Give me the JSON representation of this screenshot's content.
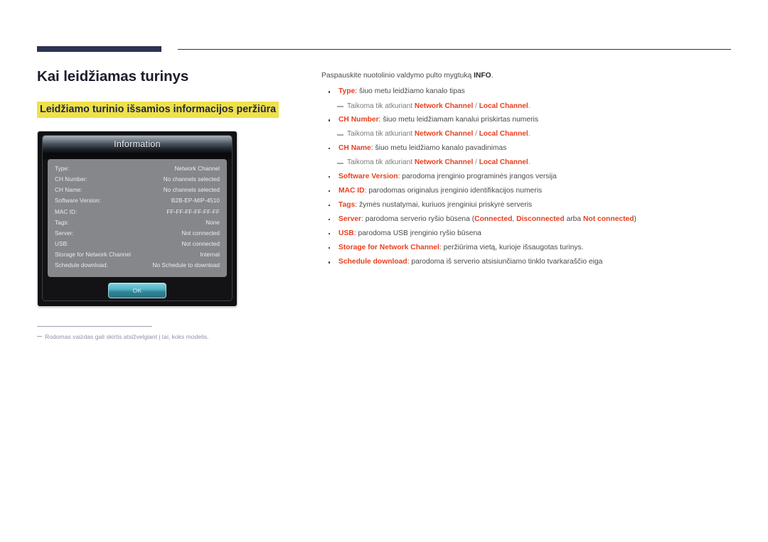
{
  "page": {
    "title": "Kai leidžiamas turinys",
    "section_title": "Leidžiamo turinio išsamios informacijos peržiūra"
  },
  "dialog": {
    "title": "Information",
    "ok_label": "OK",
    "rows": [
      {
        "label": "Type:",
        "value": "Network Channel"
      },
      {
        "label": "CH Number:",
        "value": "No channels selected"
      },
      {
        "label": "CH Name:",
        "value": "No channels selected"
      },
      {
        "label": "Software Version:",
        "value": "B2B-EP-MIP-4510"
      },
      {
        "label": "MAC ID:",
        "value": "FF-FF-FF-FF-FF-FF"
      },
      {
        "label": "Tags:",
        "value": "None"
      },
      {
        "label": "Server:",
        "value": "Not connected"
      },
      {
        "label": "USB:",
        "value": "Not connected"
      },
      {
        "label": "Storage for Network Channel",
        "value": "Internal"
      },
      {
        "label": "Schedule download:",
        "value": "No Schedule to download"
      }
    ]
  },
  "footnote": {
    "text": "Rodomas vaizdas gali skirtis atsižvelgiant į tai, koks modelis."
  },
  "content": {
    "intro_before": "Paspauskite nuotolinio valdymo pulto mygtuką ",
    "intro_bold": "INFO",
    "intro_after": ".",
    "subnote_prefix": "Taikoma tik atkuriant ",
    "subnote_kw1": "Network Channel",
    "subnote_sep": " / ",
    "subnote_kw2": "Local Channel",
    "subnote_suffix": ".",
    "items": [
      {
        "term": "Type",
        "desc": ": šiuo metu leidžiamo kanalo tipas"
      },
      {
        "term": "CH Number",
        "desc": ": šiuo metu leidžiamam kanalui priskirtas numeris"
      },
      {
        "term": "CH Name",
        "desc": ": šiuo metu leidžiamo kanalo pavadinimas"
      },
      {
        "term": "Software Version",
        "desc": ": parodoma įrenginio programinės įrangos versija"
      },
      {
        "term": "MAC ID",
        "desc": ": parodomas originalus įrenginio identifikacijos numeris"
      },
      {
        "term": "Tags",
        "desc": ": žymės nustatymai, kuriuos įrenginiui priskyrė serveris"
      },
      {
        "term": "USB",
        "desc": ": parodoma USB įrenginio ryšio būsena"
      },
      {
        "term": "Storage for Network Channel",
        "desc": ": peržiūrima vietą, kurioje išsaugotas turinys."
      },
      {
        "term": "Schedule download",
        "desc": ": parodoma iš serverio atsisiunčiamo tinklo tvarkaraščio eiga"
      }
    ],
    "server_item": {
      "term": "Server",
      "desc_a": ": parodoma serverio ryšio būsena (",
      "state1": "Connected",
      "comma": ", ",
      "state2": "Disconnected",
      "conj": " arba ",
      "state3": "Not connected",
      "desc_b": ")"
    }
  },
  "colors": {
    "accent": "#e8401f",
    "navy": "#2d3250",
    "highlight": "#efe14a"
  }
}
